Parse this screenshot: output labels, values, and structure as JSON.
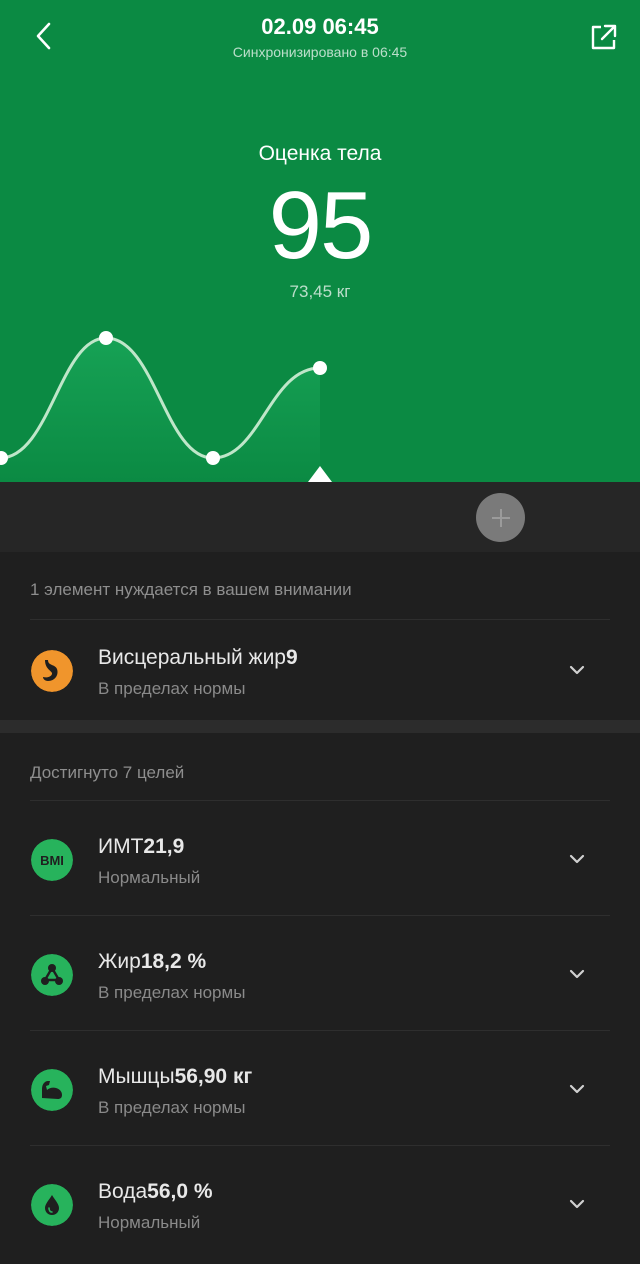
{
  "header": {
    "title": "02.09 06:45",
    "subtitle": "Синхронизировано в 06:45"
  },
  "score": {
    "label": "Оценка тела",
    "value": "95",
    "weight": "73,45 кг"
  },
  "colors": {
    "hero_green": "#0b8a43",
    "accent_green": "#27b35c",
    "warning_orange": "#f0952c",
    "background": "#1f1f1f"
  },
  "attention": {
    "heading": "1 элемент нуждается в вашем внимании",
    "items": [
      {
        "name": "Висцеральный жир",
        "value": "9",
        "status": "В пределах нормы",
        "icon": "stomach-icon"
      }
    ]
  },
  "goals": {
    "heading": "Достигнуто 7 целей",
    "items": [
      {
        "name": "ИМТ",
        "value": "21,9",
        "status": "Нормальный",
        "icon": "bmi-icon",
        "icon_text": "BMI"
      },
      {
        "name": "Жир",
        "value": "18,2 %",
        "status": "В пределах нормы",
        "icon": "fat-molecule-icon"
      },
      {
        "name": "Мышцы",
        "value": "56,90 кг",
        "status": "В пределах нормы",
        "icon": "muscle-arm-icon"
      },
      {
        "name": "Вода",
        "value": "56,0 %",
        "status": "Нормальный",
        "icon": "water-drop-icon"
      }
    ]
  }
}
